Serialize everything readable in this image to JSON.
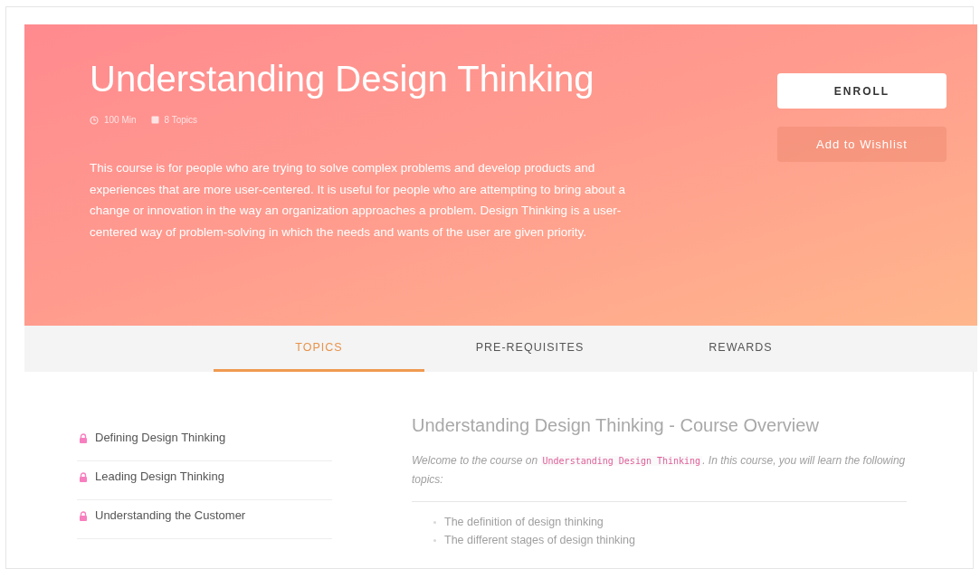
{
  "course": {
    "title": "Understanding Design Thinking",
    "meta": [
      {
        "kind": "duration",
        "text": "100 Min"
      },
      {
        "kind": "topics",
        "text": "8 Topics"
      }
    ],
    "description": "This course is for people who are trying to solve complex problems and develop products and experiences that are more user-centered. It is useful for people who are attempting to bring about a change or innovation in the way an organization approaches a problem. Design Thinking is a user-centered way of problem-solving in which the needs and wants of the user are given priority.",
    "enroll": "ENROLL",
    "wishlist": "Add to Wishlist"
  },
  "tabs": [
    {
      "label": "TOPICS",
      "selected": true
    },
    {
      "label": "PRE-REQUISITES",
      "selected": false
    },
    {
      "label": "REWARDS",
      "selected": false
    }
  ],
  "topics": [
    {
      "label": "Defining Design Thinking",
      "locked": true
    },
    {
      "label": "Leading Design Thinking",
      "locked": true
    },
    {
      "label": "Understanding the Customer",
      "locked": true
    }
  ],
  "overview": {
    "heading": "Understanding Design Thinking - Course Overview",
    "intro_before": "Welcome to the course on",
    "intro_code": "Understanding Design Thinking",
    "intro_after": ". In this course, you will learn the following topics:",
    "bullets": [
      "The definition of design thinking",
      "The different stages of design thinking"
    ]
  }
}
